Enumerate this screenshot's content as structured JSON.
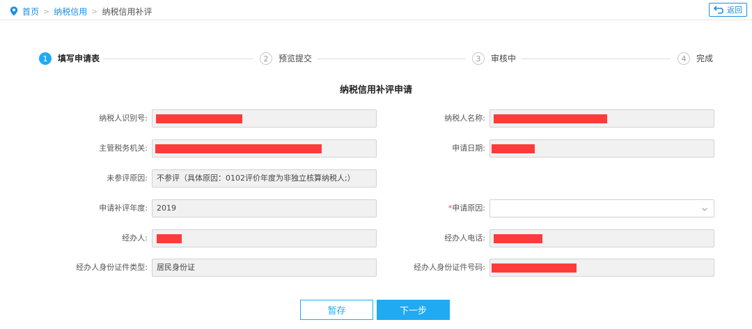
{
  "breadcrumb": {
    "home": "首页",
    "level1": "纳税信用",
    "current": "纳税信用补评",
    "separator": ">"
  },
  "back_button": {
    "label": "返回"
  },
  "steps": [
    {
      "num": "1",
      "label": "填写申请表",
      "state": "active"
    },
    {
      "num": "2",
      "label": "预览提交",
      "state": "idle"
    },
    {
      "num": "3",
      "label": "审核中",
      "state": "idle"
    },
    {
      "num": "4",
      "label": "完成",
      "state": "idle"
    }
  ],
  "form": {
    "title": "纳税信用补评申请",
    "fields": {
      "taxpayer_id": {
        "label": "纳税人识别号:",
        "value": ""
      },
      "taxpayer_name": {
        "label": "纳税人名称:",
        "value": ""
      },
      "tax_authority": {
        "label": "主管税务机关:",
        "value": ""
      },
      "apply_date": {
        "label": "申请日期:",
        "value": ""
      },
      "unrated_reason": {
        "label": "未参评原因:",
        "value": "不参评（具体原因：0102评价年度为非独立核算纳税人;）"
      },
      "rating_year": {
        "label": "申请补评年度:",
        "value": "2019"
      },
      "apply_reason": {
        "required_mark": "*",
        "label": "申请原因:",
        "value": ""
      },
      "handler": {
        "label": "经办人:",
        "value": ""
      },
      "handler_phone": {
        "label": "经办人电话:",
        "value": ""
      },
      "handler_id_type": {
        "label": "经办人身份证件类型:",
        "value": "居民身份证"
      },
      "handler_id_number": {
        "label": "经办人身份证件号码:",
        "value": ""
      }
    }
  },
  "buttons": {
    "save": "暂存",
    "next": "下一步"
  },
  "colors": {
    "accent": "#1faaf2",
    "link": "#1b8ee0",
    "redaction": "#fe3a3a",
    "required": "#e84545"
  },
  "icons": {
    "breadcrumb": "location-pin-icon",
    "back": "return-arrow-icon",
    "dropdown": "chevron-down-icon"
  }
}
